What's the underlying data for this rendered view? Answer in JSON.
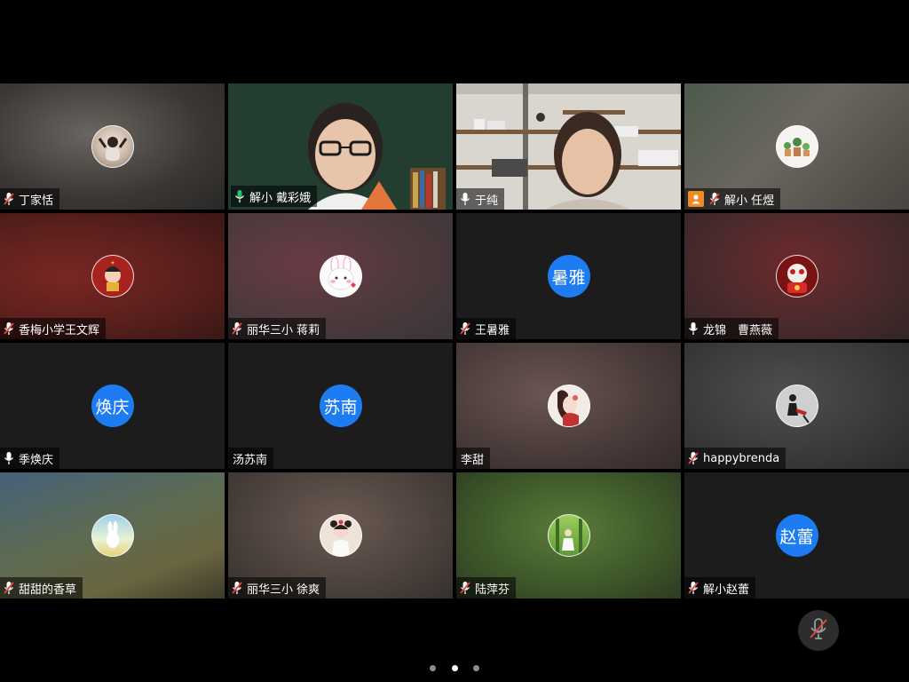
{
  "participants": [
    {
      "name": "丁家恬",
      "mic": "muted",
      "type": "avatar"
    },
    {
      "name": "解小 戴彩娥",
      "mic": "on",
      "type": "video",
      "speaking": true
    },
    {
      "name": "于纯",
      "mic": "on",
      "type": "video"
    },
    {
      "name": "解小 任煜",
      "mic": "muted",
      "type": "avatar",
      "host": true
    },
    {
      "name": "香梅小学王文辉",
      "mic": "muted",
      "type": "avatar"
    },
    {
      "name": "丽华三小 蒋莉",
      "mic": "muted",
      "type": "avatar"
    },
    {
      "name": "王暑雅",
      "mic": "muted",
      "type": "initials",
      "initials": "暑雅"
    },
    {
      "name": "龙锦　曹燕薇",
      "mic": "on",
      "type": "avatar"
    },
    {
      "name": "季焕庆",
      "mic": "on",
      "type": "initials",
      "initials": "焕庆"
    },
    {
      "name": "汤苏南",
      "mic": "none",
      "type": "initials",
      "initials": "苏南"
    },
    {
      "name": "李甜",
      "mic": "none",
      "type": "avatar"
    },
    {
      "name": "happybrenda",
      "mic": "muted",
      "type": "avatar"
    },
    {
      "name": "甜甜的香草",
      "mic": "muted",
      "type": "avatar"
    },
    {
      "name": "丽华三小 徐爽",
      "mic": "muted",
      "type": "avatar"
    },
    {
      "name": "陆萍芬",
      "mic": "muted",
      "type": "avatar"
    },
    {
      "name": "解小赵蕾",
      "mic": "muted",
      "type": "initials",
      "initials": "赵蕾"
    }
  ],
  "colors": {
    "accent": "#1e7cf2",
    "speaking_border": "#27c26a",
    "host_badge": "#f08a24"
  },
  "pager": {
    "pages": 3,
    "current": 2
  },
  "controls": {
    "mute_icon": "mic-muted-icon"
  }
}
